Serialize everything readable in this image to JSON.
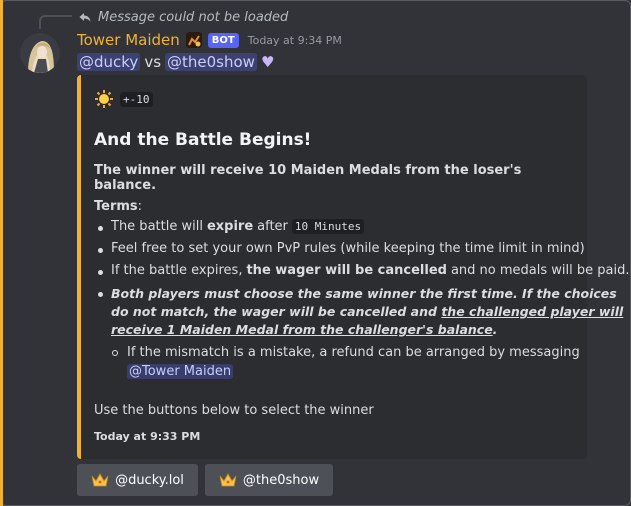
{
  "reply": {
    "text": "Message could not be loaded"
  },
  "message": {
    "username": "Tower Maiden",
    "bot_tag": "BOT",
    "timestamp": "Today at 9:34 PM",
    "mention_a": "@ducky",
    "versus": "vs",
    "mention_b": "@the0show",
    "icons": [
      "reply-arrow-icon",
      "role-icon",
      "heart-icon"
    ]
  },
  "embed": {
    "accent_color": "#f0b232",
    "author_emoji": "sun-icon",
    "author_code": "+-10",
    "title": "And the Battle Begins!",
    "subtitle": "The winner will receive 10 Maiden Medals from the loser's balance.",
    "terms_label": "Terms",
    "terms_colon": ":",
    "bullets": {
      "b1_pre": "The battle will",
      "b1_bold": "expire",
      "b1_post": "after",
      "b1_code": "10 Minutes",
      "b2": "Feel free to set your own PvP rules (while keeping the time limit in mind)",
      "b3_pre": "If the battle expires,",
      "b3_bold": "the wager will be cancelled",
      "b3_post": "and no medals will be paid.",
      "b4_line1": "Both players must choose the same winner the first time. If the choices",
      "b4_line2_pre": "do not match, the wager will be cancelled and",
      "b4_line2_ul": "the challenged player will",
      "b4_line3_ul": "receive 1 Maiden Medal from the challenger's balance",
      "b4_line3_post": ".",
      "sub_line1": "If the mismatch is a mistake, a refund can be arranged by messaging",
      "sub_mention": "@Tower Maiden"
    },
    "instruction": "Use the buttons below to select the winner",
    "footer": "Today at 9:33 PM"
  },
  "buttons": [
    {
      "label": "@ducky.lol",
      "icon": "crown-icon"
    },
    {
      "label": "@the0show",
      "icon": "crown-icon"
    }
  ],
  "colors": {
    "background": "#323339",
    "username": "#f0b232",
    "bot_tag": "#5865f2",
    "button": "#4e5058",
    "mention": "#c9cdfb"
  }
}
